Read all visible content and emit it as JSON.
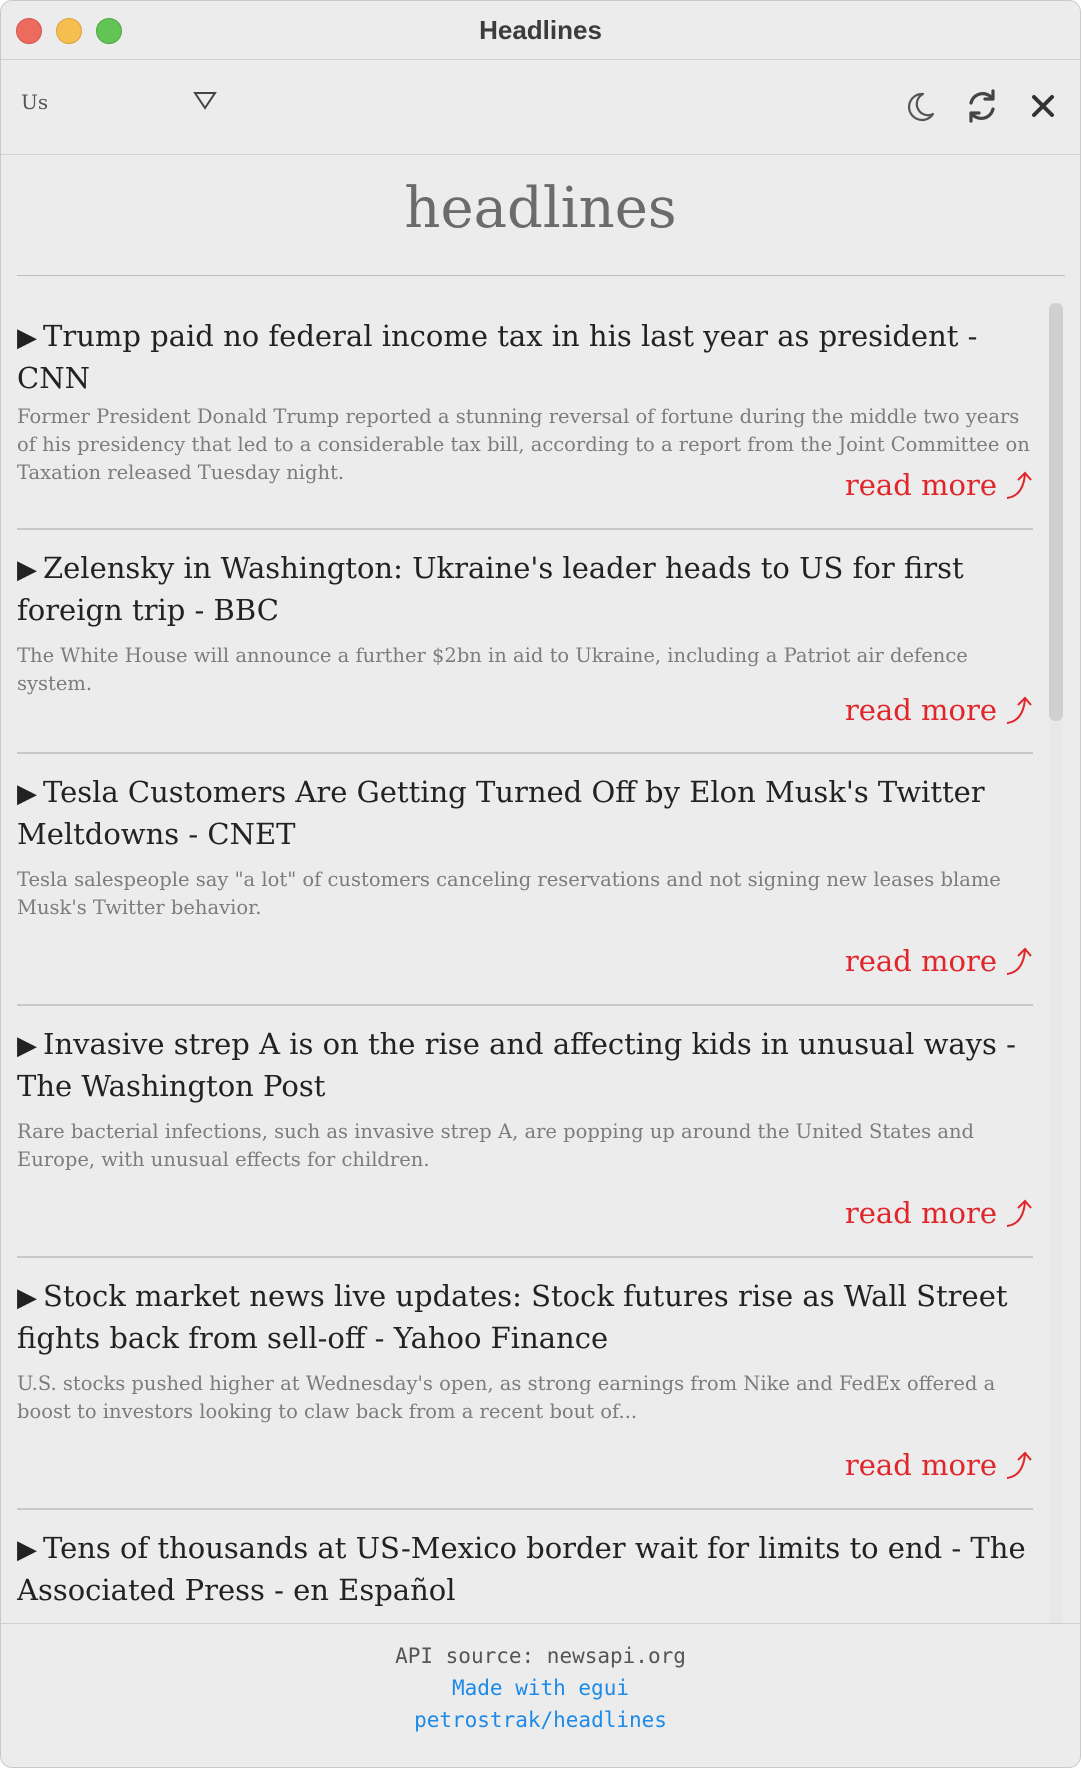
{
  "window": {
    "title": "Headlines"
  },
  "toolbar": {
    "country": "Us",
    "icons": [
      "chevron-down-icon",
      "moon-icon",
      "refresh-icon",
      "close-icon"
    ]
  },
  "main": {
    "heading": "headlines",
    "read_more_label": "read more",
    "articles": [
      {
        "title": "Trump paid no federal income tax in his last year as president - CNN",
        "description": "Former President Donald Trump reported a stunning reversal of fortune during the middle two years of his presidency that led to a considerable tax bill, according to a report from the Joint Committee on Taxation released Tuesday night."
      },
      {
        "title": "Zelensky in Washington: Ukraine's leader heads to US for first foreign trip - BBC",
        "description": "The White House will announce a further $2bn in aid to Ukraine, including a Patriot air defence system."
      },
      {
        "title": "Tesla Customers Are Getting Turned Off by Elon Musk's Twitter Meltdowns - CNET",
        "description": "Tesla salespeople say \"a lot\" of customers canceling reservations and not signing new leases blame Musk's Twitter behavior."
      },
      {
        "title": "Invasive strep A is on the rise and affecting kids in unusual ways - The Washington Post",
        "description": "Rare bacterial infections, such as invasive strep A, are popping up around the United States and Europe, with unusual effects for children."
      },
      {
        "title": "Stock market news live updates: Stock futures rise as Wall Street fights back from sell-off - Yahoo Finance",
        "description": "U.S. stocks pushed higher at Wednesday's open, as strong earnings from Nike and FedEx offered a boost to investors looking to claw back from a recent bout of..."
      },
      {
        "title": "Tens of thousands at US-Mexico border wait for limits to end - The Associated Press - en Español",
        "description": ""
      }
    ]
  },
  "footer": {
    "source": "API source: newsapi.org",
    "made_with": "Made with egui",
    "repo": "petrostrak/headlines"
  },
  "colors": {
    "background": "#ececec",
    "read_more": "#e0262a",
    "link": "#1b8ae8"
  }
}
